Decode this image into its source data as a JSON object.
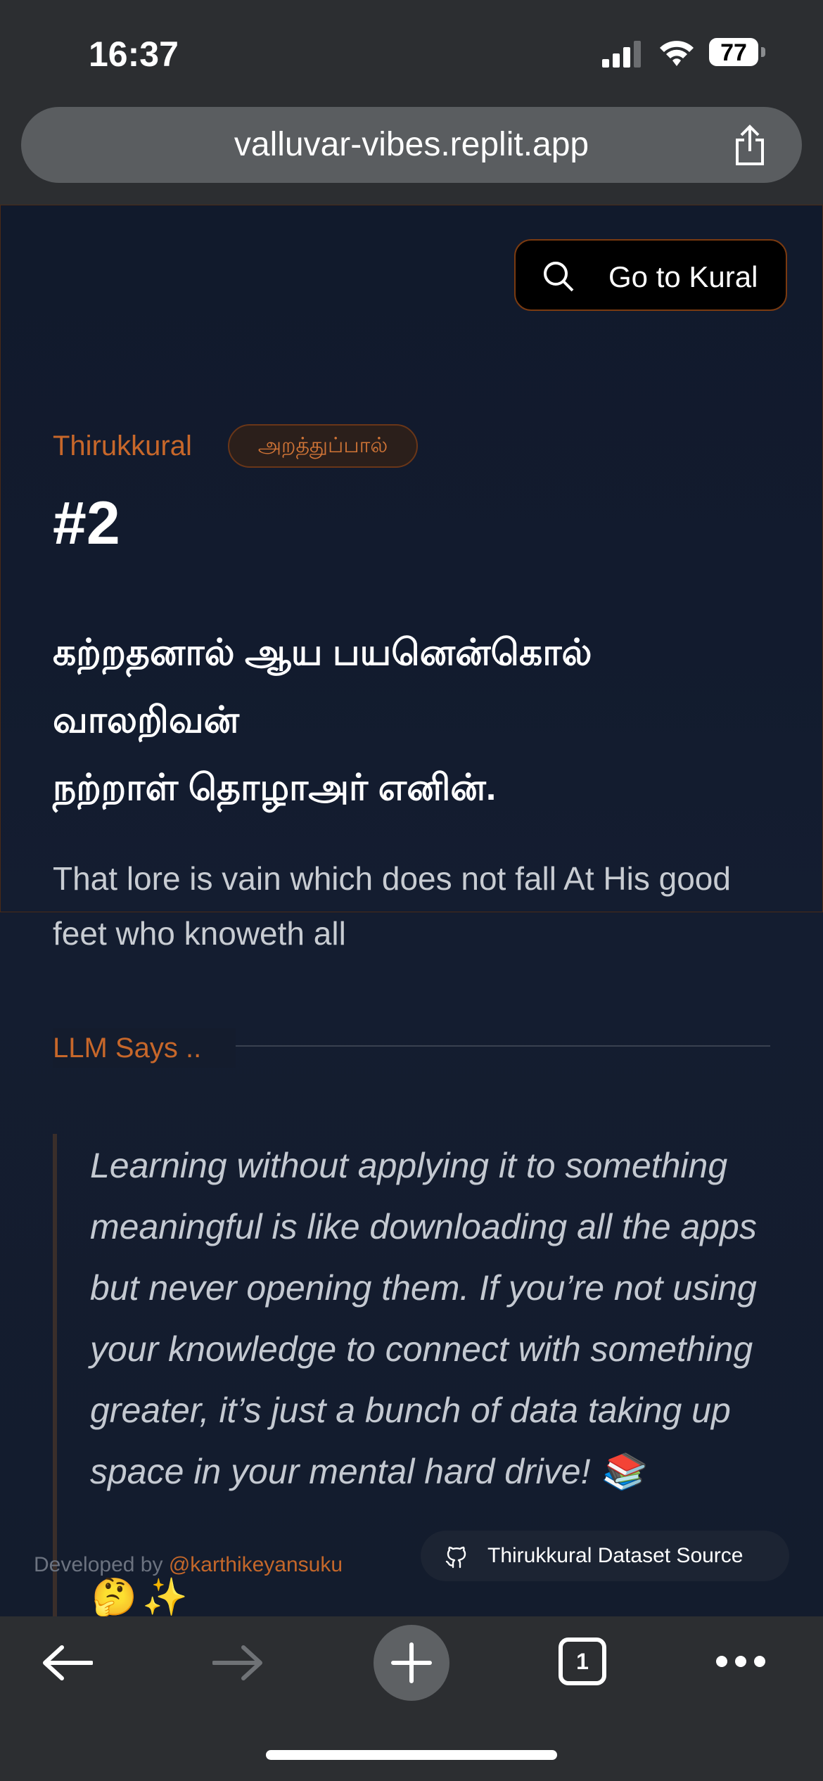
{
  "status_bar": {
    "time": "16:37",
    "battery": "77"
  },
  "browser": {
    "url": "valluvar-vibes.replit.app",
    "tab_count": "1"
  },
  "header": {
    "goto_label": "Go to Kural"
  },
  "kural": {
    "source": "Thirukkural",
    "paal": "அறத்துப்பால்",
    "number": "#2",
    "tamil_lines": [
      "கற்றதனால் ஆய பயனென்கொல்",
      "வாலறிவன்",
      "நற்றாள் தொழாஅர் எனின்."
    ],
    "english": "That lore is vain which does not fall At His good feet who knoweth all"
  },
  "llm": {
    "heading": "LLM Says ..",
    "text": "Learning without applying it to something meaningful is like downloading all the apps but never opening them. If you’re not using your knowledge to connect with something greater, it’s just a bunch of data taking up space in your mental hard drive! 📚",
    "emojis": [
      "🤔",
      "✨"
    ]
  },
  "footer": {
    "developed_by": "Developed by",
    "handle": "@karthikeyansuku",
    "dataset_label": "Thirukkural Dataset Source"
  },
  "icons": [
    "share-icon",
    "search-icon",
    "github-icon",
    "back-icon",
    "forward-icon",
    "plus-icon",
    "more-icon"
  ]
}
